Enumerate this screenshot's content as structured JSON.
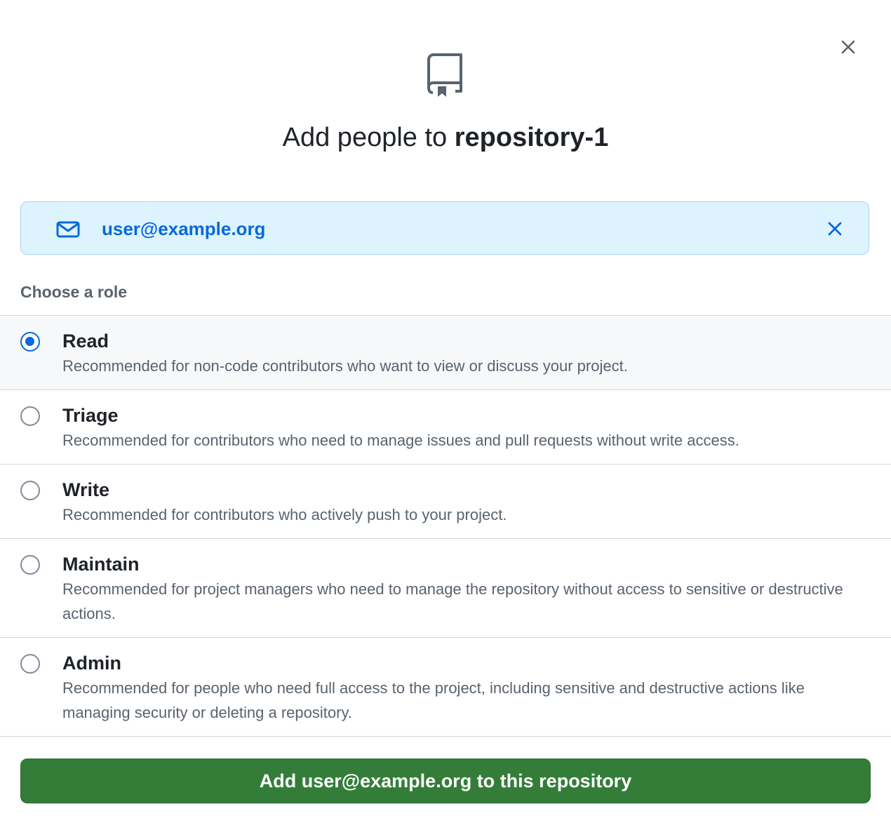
{
  "dialog": {
    "title_prefix": "Add people to ",
    "repo_name": "repository-1",
    "close_icon": "x-icon",
    "header_icon": "repo-icon"
  },
  "invitee": {
    "icon": "mail-icon",
    "email": "user@example.org",
    "remove_icon": "x-icon"
  },
  "role_heading": "Choose a role",
  "roles": [
    {
      "name": "Read",
      "description": "Recommended for non-code contributors who want to view or discuss your project.",
      "selected": true
    },
    {
      "name": "Triage",
      "description": "Recommended for contributors who need to manage issues and pull requests without write access.",
      "selected": false
    },
    {
      "name": "Write",
      "description": "Recommended for contributors who actively push to your project.",
      "selected": false
    },
    {
      "name": "Maintain",
      "description": "Recommended for project managers who need to manage the repository without access to sensitive or destructive actions.",
      "selected": false
    },
    {
      "name": "Admin",
      "description": "Recommended for people who need full access to the project, including sensitive and destructive actions like managing security or deleting a repository.",
      "selected": false
    }
  ],
  "submit_label": "Add user@example.org to this repository",
  "colors": {
    "accent": "#0969da",
    "chip_bg": "#ddf4ff",
    "primary_button": "#347d39",
    "selected_row_bg": "#f6f8fa"
  }
}
